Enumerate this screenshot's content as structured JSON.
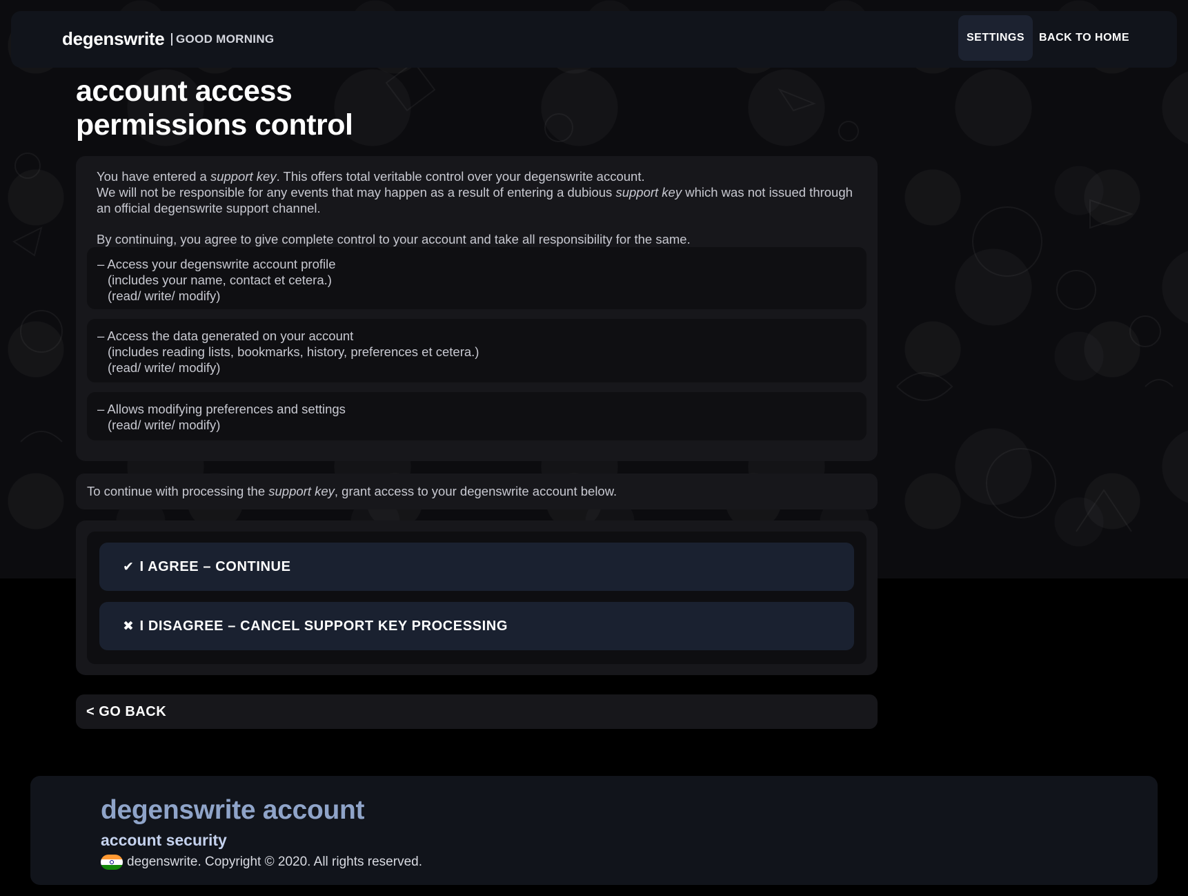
{
  "header": {
    "brand": "degenswrite",
    "greeting": "GOOD MORNING",
    "settings_label": "SETTINGS",
    "home_label": "BACK TO HOME"
  },
  "page": {
    "title_line1": "account access",
    "title_line2": "permissions control"
  },
  "info": {
    "p1_a": "You have entered a ",
    "p1_key": "support key",
    "p1_b": ". This offers total veritable control over your degenswrite account.",
    "p1_c": "We will not be responsible for any events that may happen as a result of entering a dubious ",
    "p1_key2": "support key",
    "p1_d": " which was not issued through an official degenswrite support channel.",
    "p2": "By continuing, you agree to give complete control to your account and take all responsibility for the same."
  },
  "permissions": [
    {
      "title": "– Access your degenswrite account profile",
      "detail": "(includes your name, contact et cetera.)",
      "mode": "(read/ write/ modify)"
    },
    {
      "title": "– Access the data generated on your account",
      "detail": "(includes reading lists, bookmarks, history, preferences et cetera.)",
      "mode": "(read/ write/ modify)"
    },
    {
      "title": "– Allows modifying preferences and settings",
      "mode": "(read/ write/ modify)"
    }
  ],
  "continue_note": {
    "a": "To continue with processing the ",
    "key": "support key",
    "b": ", grant access to your degenswrite account below."
  },
  "actions": {
    "agree_icon": "check-icon",
    "agree_label": "I AGREE – CONTINUE",
    "disagree_icon": "cross-icon",
    "disagree_label": "I DISAGREE – CANCEL SUPPORT KEY PROCESSING",
    "go_back_label": "< GO BACK"
  },
  "footer": {
    "title": "degenswrite account",
    "subtitle": "account security",
    "copyright": "degenswrite. Copyright © 2020. All rights reserved.",
    "flag_icon": "india-flag-icon"
  }
}
